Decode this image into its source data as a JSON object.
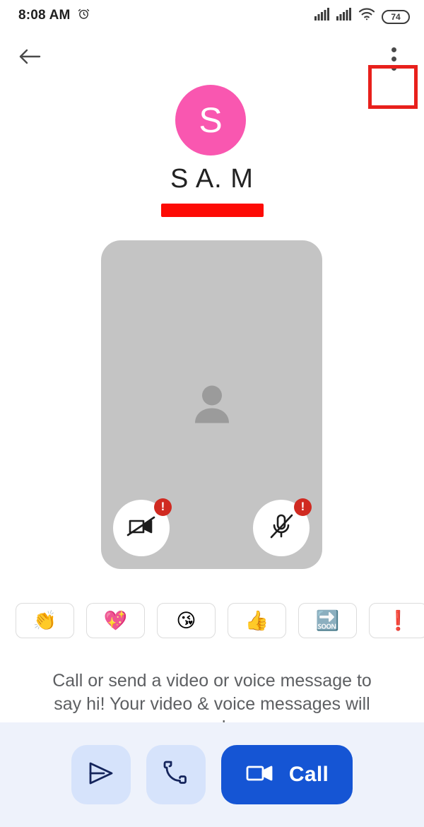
{
  "status_bar": {
    "time": "8:08 AM",
    "alarm_icon": "alarm-clock-icon",
    "signal_icon_1": "cellular-signal-icon",
    "signal_icon_2": "cellular-signal-icon",
    "wifi_icon": "wifi-icon",
    "battery_level": "74"
  },
  "app_bar": {
    "back_icon": "back-arrow-icon",
    "overflow_icon": "overflow-menu-icon",
    "highlight_color": "#e8201c"
  },
  "profile": {
    "avatar_letter": "S",
    "avatar_color": "#f957b0",
    "name": "S A. M",
    "redaction_color": "#fd0b05"
  },
  "video_preview": {
    "placeholder_icon": "person-placeholder-icon",
    "card_color": "#c4c4c4",
    "controls": [
      {
        "name": "camera-off-button",
        "icon": "videocam-off-icon",
        "badge": "!"
      },
      {
        "name": "mic-off-button",
        "icon": "mic-off-icon",
        "badge": "!"
      }
    ]
  },
  "emoji_row": [
    {
      "name": "emoji-chip-clap",
      "glyph": "👏"
    },
    {
      "name": "emoji-chip-sparkling-heart",
      "glyph": "💖"
    },
    {
      "name": "emoji-chip-kissing-face",
      "glyph": "😘"
    },
    {
      "name": "emoji-chip-thumbs-up",
      "glyph": "👍"
    },
    {
      "name": "emoji-chip-soon",
      "glyph": "🔜"
    },
    {
      "name": "emoji-chip-exclamation",
      "glyph": "❗"
    }
  ],
  "hint": {
    "text": "Call or send a video or voice message to say hi! Your video & voice messages will appear here."
  },
  "bottom_bar": {
    "background": "#eef2fb",
    "send_icon": "send-icon",
    "phone_icon": "phone-icon",
    "call_icon": "videocam-icon",
    "call_label": "Call",
    "call_color": "#1555d4"
  }
}
